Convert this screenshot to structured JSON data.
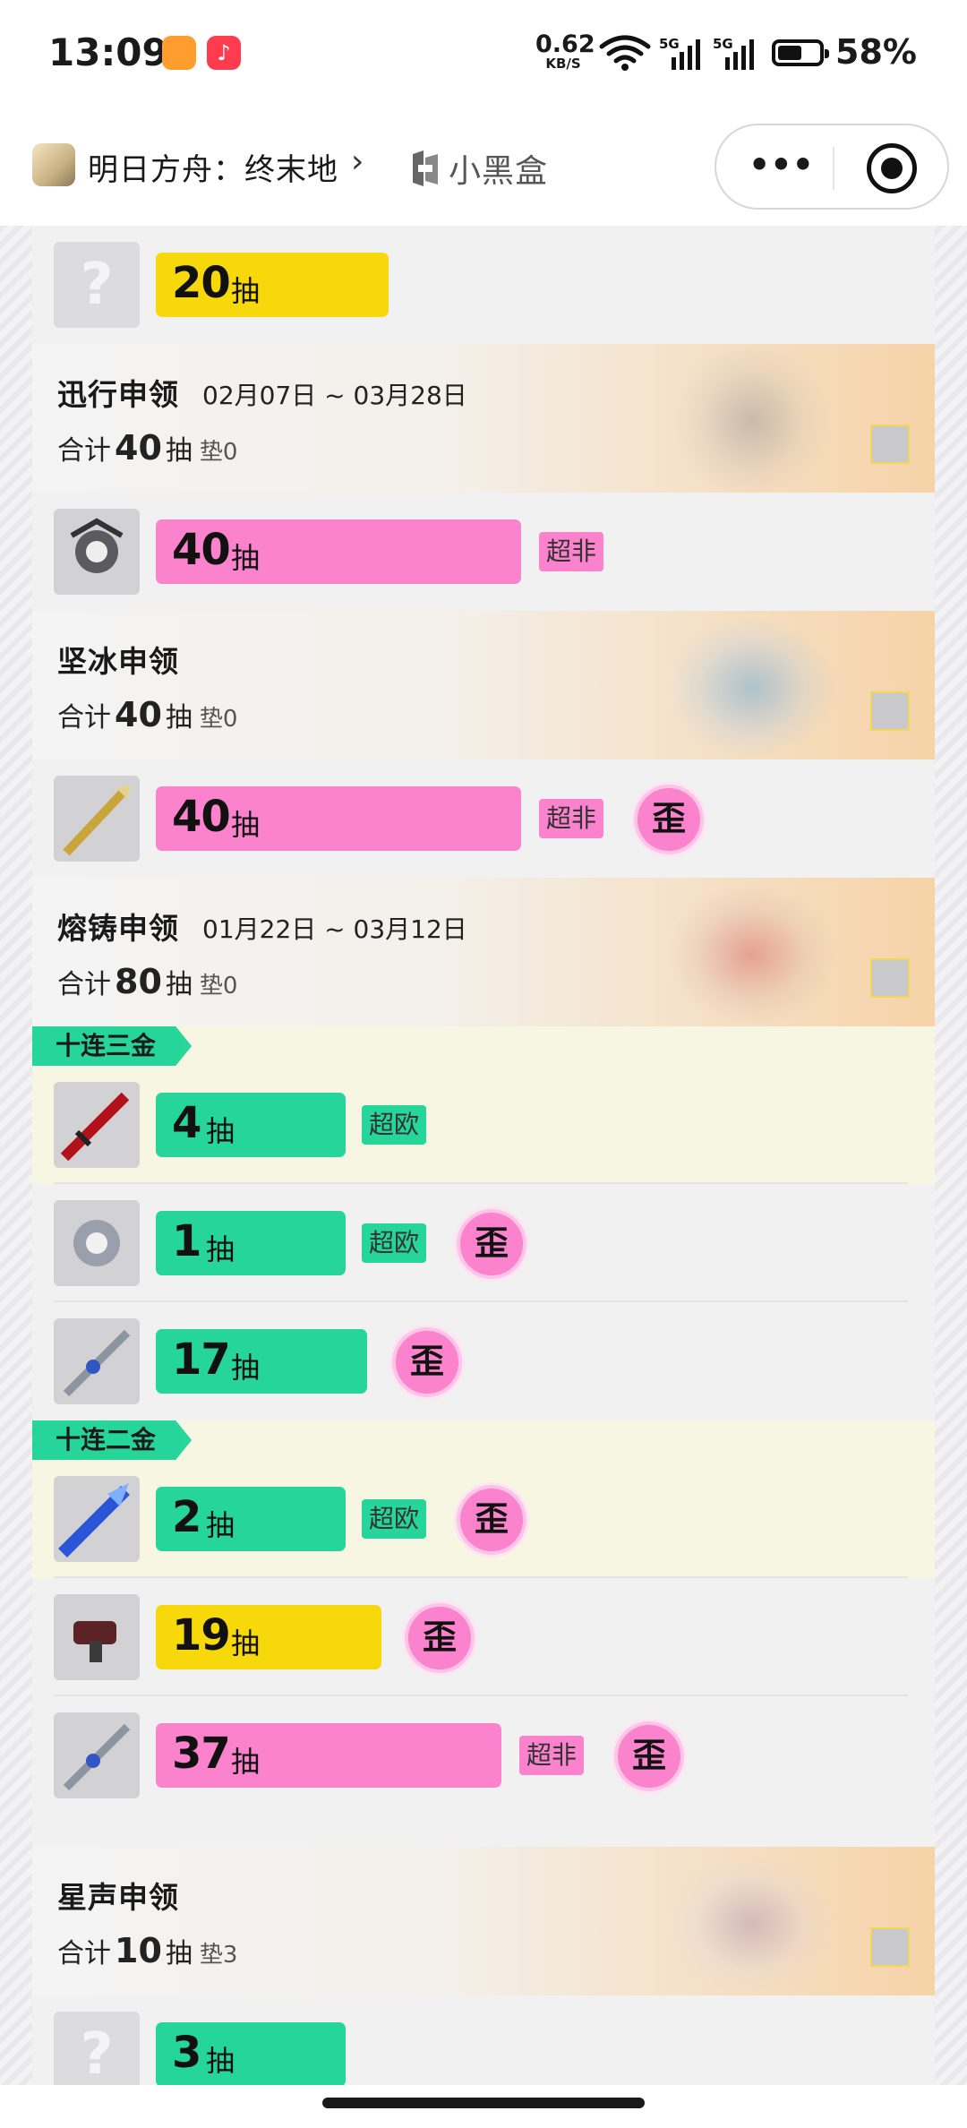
{
  "status_bar": {
    "time": "13:09",
    "net_speed": "0.62",
    "net_unit": "KB/S",
    "signal1": "5G",
    "signal2": "5G",
    "battery_level": 0.58,
    "battery": "58%"
  },
  "title_bar": {
    "app_name": "明日方舟：终末地",
    "chevron": "›",
    "brand": "小黑盒",
    "more_label": "•••"
  },
  "unit": "抽",
  "rows": [
    {
      "icon": "unknown-weapon-icon",
      "unknown": true,
      "count": "20",
      "bar": "yellow",
      "badge": "",
      "wai": ""
    },
    {
      "icon": "crown-gear-icon",
      "count": "40",
      "bar": "pink",
      "badge": "超非",
      "wai": ""
    },
    {
      "icon": "golden-lance-icon",
      "count": "40",
      "bar": "pink",
      "badge": "超非",
      "wai": "歪"
    },
    {
      "icon": "red-sword-icon",
      "count": "4",
      "bar": "green",
      "badge": "超欧",
      "wai": ""
    },
    {
      "icon": "silver-emblem-icon",
      "count": "1",
      "bar": "green",
      "badge": "超欧",
      "wai": "歪"
    },
    {
      "icon": "blue-blade-icon",
      "count": "17",
      "bar": "green",
      "badge": "",
      "wai": "歪"
    },
    {
      "icon": "blue-greatsword-icon",
      "count": "2",
      "bar": "green",
      "badge": "超欧",
      "wai": "歪"
    },
    {
      "icon": "red-cannon-icon",
      "count": "19",
      "bar": "yellow",
      "badge": "",
      "wai": "歪"
    },
    {
      "icon": "blue-blade-icon",
      "count": "37",
      "bar": "pink",
      "badge": "超非",
      "wai": "歪"
    },
    {
      "icon": "unknown-weapon-icon",
      "unknown": true,
      "count": "3",
      "bar": "green",
      "badge": "",
      "wai": ""
    }
  ],
  "banners": [
    {
      "title": "迅行申领",
      "date": "02月07日 ~ 03月28日",
      "sum_prefix": "合计",
      "total": "40",
      "pad": "垫0"
    },
    {
      "title": "坚冰申领",
      "date": "",
      "sum_prefix": "合计",
      "total": "40",
      "pad": "垫0"
    },
    {
      "title": "熔铸申领",
      "date": "01月22日 ~ 03月12日",
      "sum_prefix": "合计",
      "total": "80",
      "pad": "垫0"
    },
    {
      "title": "星声申领",
      "date": "",
      "sum_prefix": "合计",
      "total": "10",
      "pad": "垫3"
    }
  ],
  "tags": [
    "十连三金",
    "十连二金"
  ],
  "question_mark": "?",
  "colors": {
    "yellow": "#f7d80a",
    "pink": "#fb82cc",
    "green": "#25d59a"
  }
}
